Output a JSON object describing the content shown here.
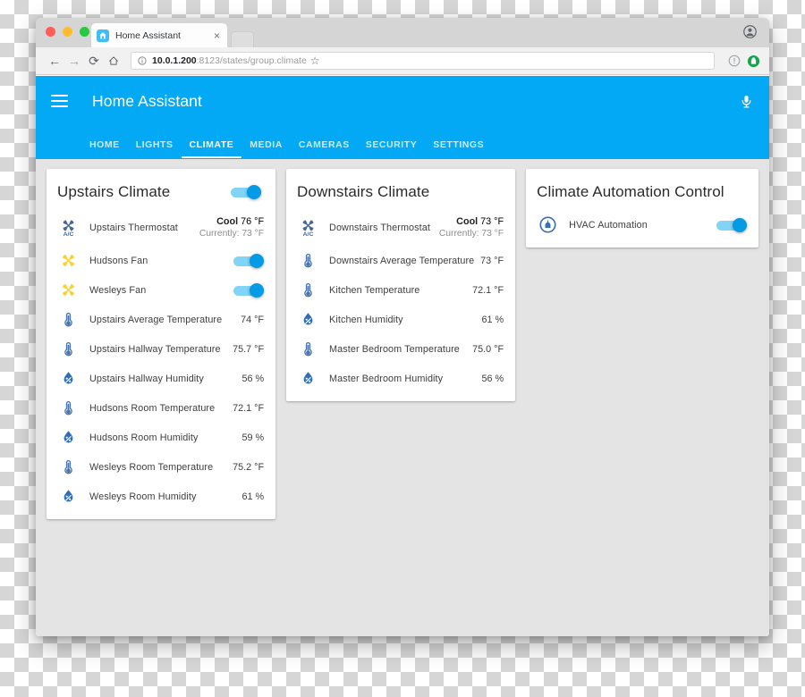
{
  "browser": {
    "tab": {
      "title": "Home Assistant",
      "favicon": "home-icon",
      "close": "×"
    },
    "nav": {
      "back": "←",
      "forward": "→",
      "reload": "⟳",
      "home": "⌂"
    },
    "url": {
      "info_icon": "info-circle-icon",
      "host": "10.0.1.200",
      "rest": ":8123/states/group.climate",
      "star": "☆"
    },
    "extensions": {
      "info": "info-icon",
      "shield": "extension-icon"
    },
    "profile": "profile-avatar"
  },
  "app": {
    "title": "Home Assistant",
    "menu_icon": "hamburger-menu-icon",
    "voice_icon": "microphone-icon",
    "accent_color": "#03a9f4",
    "tabs": [
      {
        "label": "HOME",
        "selected": false
      },
      {
        "label": "LIGHTS",
        "selected": false
      },
      {
        "label": "CLIMATE",
        "selected": true
      },
      {
        "label": "MEDIA",
        "selected": false
      },
      {
        "label": "CAMERAS",
        "selected": false
      },
      {
        "label": "SECURITY",
        "selected": false
      },
      {
        "label": "SETTINGS",
        "selected": false
      }
    ]
  },
  "cards": [
    {
      "title": "Upstairs Climate",
      "header_toggle": {
        "state": "on"
      },
      "rows": [
        {
          "icon": "ac-thermostat-icon",
          "label": "Upstairs Thermostat",
          "type": "thermostat",
          "mode": "Cool",
          "target": "76 °F",
          "current": "Currently: 73 °F"
        },
        {
          "icon": "fan-icon",
          "label": "Hudsons Fan",
          "type": "toggle",
          "state": "on"
        },
        {
          "icon": "fan-icon",
          "label": "Wesleys Fan",
          "type": "toggle",
          "state": "on"
        },
        {
          "icon": "thermometer-icon",
          "label": "Upstairs Average Temperature",
          "type": "value",
          "value": "74 °F"
        },
        {
          "icon": "thermometer-icon",
          "label": "Upstairs Hallway Temperature",
          "type": "value",
          "value": "75.7 °F"
        },
        {
          "icon": "humidity-icon",
          "label": "Upstairs Hallway Humidity",
          "type": "value",
          "value": "56 %"
        },
        {
          "icon": "thermometer-icon",
          "label": "Hudsons Room Temperature",
          "type": "value",
          "value": "72.1 °F"
        },
        {
          "icon": "humidity-icon",
          "label": "Hudsons Room Humidity",
          "type": "value",
          "value": "59 %"
        },
        {
          "icon": "thermometer-icon",
          "label": "Wesleys Room Temperature",
          "type": "value",
          "value": "75.2 °F"
        },
        {
          "icon": "humidity-icon",
          "label": "Wesleys Room Humidity",
          "type": "value",
          "value": "61 %"
        }
      ]
    },
    {
      "title": "Downstairs Climate",
      "header_toggle": null,
      "rows": [
        {
          "icon": "ac-thermostat-icon",
          "label": "Downstairs Thermostat",
          "type": "thermostat",
          "mode": "Cool",
          "target": "73 °F",
          "current": "Currently: 73 °F"
        },
        {
          "icon": "thermometer-icon",
          "label": "Downstairs Average Temperature",
          "type": "value",
          "value": "73 °F"
        },
        {
          "icon": "thermometer-icon",
          "label": "Kitchen Temperature",
          "type": "value",
          "value": "72.1 °F"
        },
        {
          "icon": "humidity-icon",
          "label": "Kitchen Humidity",
          "type": "value",
          "value": "61 %"
        },
        {
          "icon": "thermometer-icon",
          "label": "Master Bedroom Temperature",
          "type": "value",
          "value": "75.0 °F"
        },
        {
          "icon": "humidity-icon",
          "label": "Master Bedroom Humidity",
          "type": "value",
          "value": "56 %"
        }
      ]
    },
    {
      "title": "Climate Automation Control",
      "header_toggle": null,
      "rows": [
        {
          "icon": "automation-robot-icon",
          "label": "HVAC Automation",
          "type": "toggle",
          "state": "on"
        }
      ]
    }
  ]
}
